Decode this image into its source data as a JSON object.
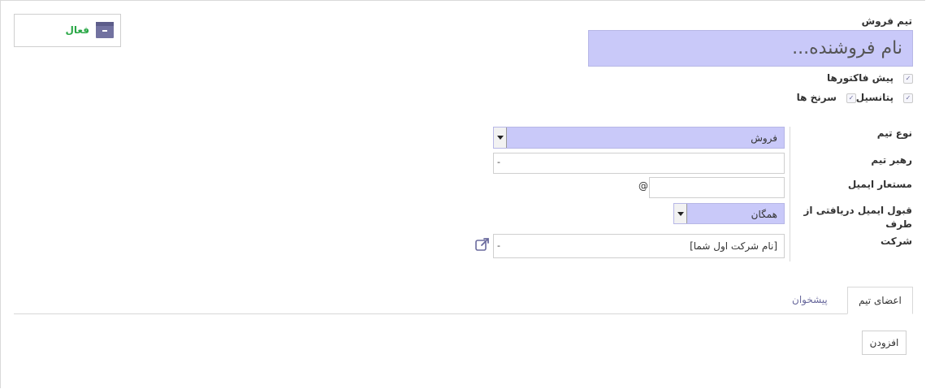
{
  "status": {
    "active_label": "فعال"
  },
  "form": {
    "name_label": "تیم فروش",
    "name_placeholder": "نام فروشنده...",
    "checkboxes": [
      {
        "label": "پیش فاکتورها",
        "checked": true
      },
      {
        "label": "پتانسیل",
        "checked": true
      },
      {
        "label": "سرنخ ها",
        "checked": true
      }
    ],
    "team_type": {
      "label": "نوع تیم",
      "value": "فروش"
    },
    "team_leader": {
      "label": "رهبر تیم",
      "value": "-"
    },
    "email_alias": {
      "label": "مستعار ایمیل",
      "at": "@",
      "value": ""
    },
    "accept_emails": {
      "label": "قبول ایمیل دریافتی از طرف",
      "value": "همگان"
    },
    "company": {
      "label": "شرکت",
      "value": "[نام شرکت اول شما]",
      "caret": "-"
    }
  },
  "tabs": [
    {
      "label": "اعضای تیم",
      "active": true
    },
    {
      "label": "پیشخوان",
      "active": false
    }
  ],
  "actions": {
    "add_label": "افزودن"
  },
  "colors": {
    "accent": "#c9c9f9",
    "active_green": "#28a745",
    "tab_link": "#6b6b9e"
  }
}
